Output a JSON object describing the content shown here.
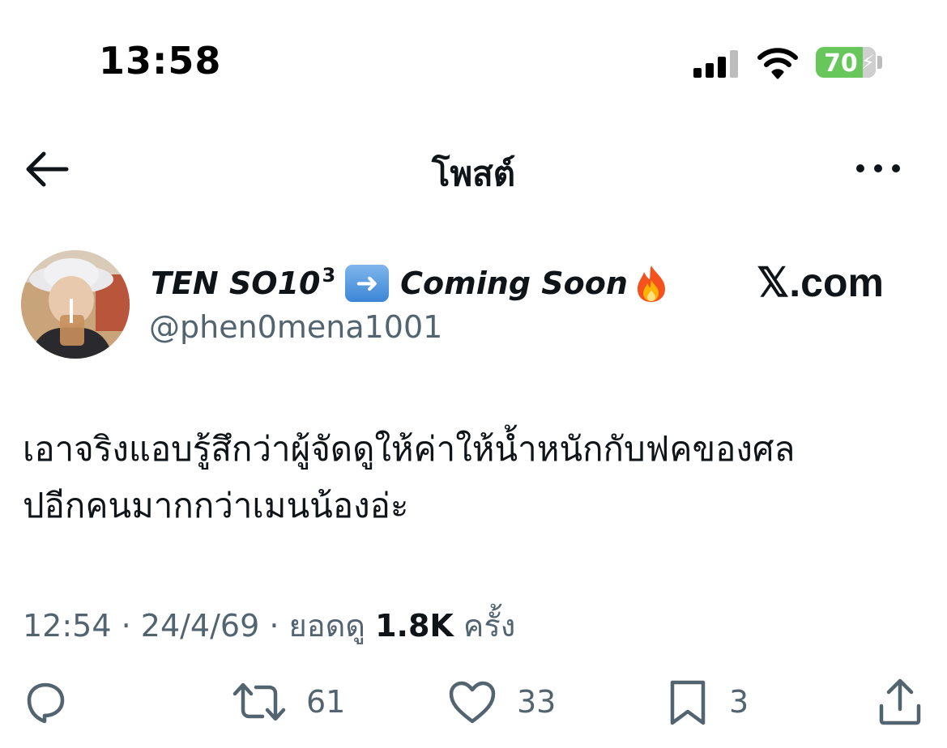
{
  "status_bar": {
    "time": "13:58",
    "battery_level": "70",
    "battery_color": "#67c75a"
  },
  "nav": {
    "title": "โพสต์",
    "back_icon": "arrow-left-icon",
    "more_icon": "more-horizontal-icon"
  },
  "post": {
    "author": {
      "name": "TEN SO10",
      "name_superscript": "3",
      "name_suffix": "Coming Soon",
      "handle": "@phen0mena1001"
    },
    "watermark": "𝕏.com",
    "text_lines": [
      "เอาจริงแอบรู้สึกว่าผู้จัดดูให้ค่าให้น้ำหนักกับฟคของศล",
      "ปอีกคนมากกว่าเมนน้องอ่ะ"
    ],
    "meta": {
      "time": "12:54",
      "date": "24/4/69",
      "views_label": "ยอดดู",
      "views_count": "1.8K",
      "views_suffix": "ครั้ง"
    },
    "actions": {
      "reply_icon": "reply-icon",
      "repost_icon": "repost-icon",
      "repost_count": "61",
      "like_icon": "heart-icon",
      "like_count": "33",
      "bookmark_icon": "bookmark-icon",
      "bookmark_count": "3",
      "share_icon": "share-icon"
    }
  }
}
